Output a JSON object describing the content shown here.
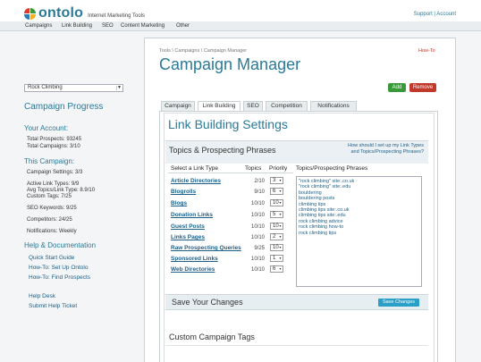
{
  "header": {
    "brand": "ontolo",
    "tagline": "Internet Marketing Tools",
    "top_links": "Support | Account",
    "logo_colors": [
      "#e03a2f",
      "#3a9a3a",
      "#2a7ab8",
      "#f0b020"
    ]
  },
  "nav": {
    "items": [
      "Campaigns",
      "Link Building",
      "SEO",
      "Content Marketing",
      "Other"
    ]
  },
  "sidebar": {
    "campaign_select": "Rock Climbing",
    "progress_title": "Campaign Progress",
    "account_title": "Your Account:",
    "account_lines": [
      "Total Prospects: 93245",
      "Total Campaigns: 3/10"
    ],
    "campaign_title": "This Campaign:",
    "campaign_lines": [
      "Campaign Settings: 3/3",
      "Active Link Types: 9/9",
      "Avg Topics/Link Type: 8.9/10",
      "Custom Tags: 7/25",
      "SEO Keywords: 9/25",
      "Competitors: 24/25",
      "Notifications: Weekly"
    ],
    "help_title": "Help & Documentation",
    "help_links": [
      "Quick Start Guide",
      "How-To: Set Up Ontolo",
      "How-To: Find Prospects"
    ],
    "support_links": [
      "Help Desk",
      "Submit Help Ticket"
    ]
  },
  "main": {
    "breadcrumb": "Tools \\ Campaigns \\ Campaign Manager",
    "howto": "How-To",
    "title": "Campaign Manager",
    "add_label": "Add",
    "remove_label": "Remove",
    "tabs": [
      "Campaign",
      "Link Building",
      "SEO",
      "Competition",
      "Notifications"
    ],
    "active_tab": "Link Building"
  },
  "panel": {
    "title": "Link Building Settings",
    "topics_heading": "Topics & Prospecting Phrases",
    "help_question": "How should I set up my Link Types and Topics/Prospecting Phrases?",
    "columns": [
      "Select a Link Type",
      "Topics",
      "Priority",
      "Topics/Prospecting Phrases"
    ],
    "link_types": [
      {
        "name": "Article Directories",
        "topics": "2/10",
        "priority": "3"
      },
      {
        "name": "Blogrolls",
        "topics": "9/10",
        "priority": "6"
      },
      {
        "name": "Blogs",
        "topics": "10/10",
        "priority": "10"
      },
      {
        "name": "Donation Links",
        "topics": "10/10",
        "priority": "5"
      },
      {
        "name": "Guest Posts",
        "topics": "10/10",
        "priority": "10"
      },
      {
        "name": "Links Pages",
        "topics": "10/10",
        "priority": "2"
      },
      {
        "name": "Raw Prospecting Queries",
        "topics": "9/25",
        "priority": "10"
      },
      {
        "name": "Sponsored Links",
        "topics": "10/10",
        "priority": "1"
      },
      {
        "name": "Web Directories",
        "topics": "10/10",
        "priority": "6"
      }
    ],
    "phrases": [
      "\"rock climbing\" site:.co.uk",
      "\"rock climbing\" site:.edu",
      "bouldering",
      "bouldering posts",
      "climbing tips",
      "climbing tips site:.co.uk",
      "climbing tips site:.edu",
      "rock climbing advice",
      "rock climbing how-to",
      "rock climbing tips"
    ],
    "save_heading": "Save Your Changes",
    "save_button": "Save Changes",
    "custom_heading": "Custom Campaign Tags"
  }
}
